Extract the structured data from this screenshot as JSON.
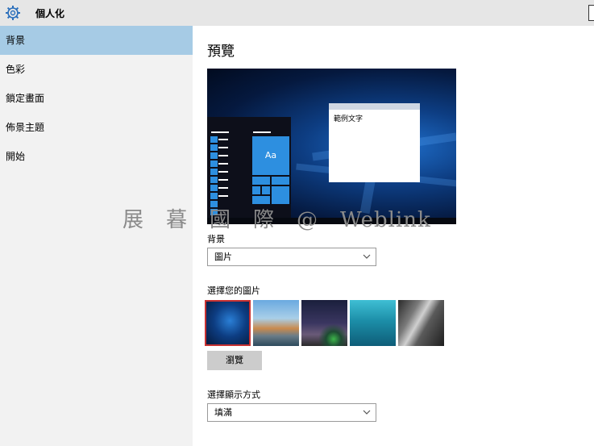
{
  "app": {
    "title": "個人化"
  },
  "sidebar": {
    "items": [
      {
        "label": "背景"
      },
      {
        "label": "色彩"
      },
      {
        "label": "鎖定畫面"
      },
      {
        "label": "佈景主題"
      },
      {
        "label": "開始"
      }
    ]
  },
  "main": {
    "heading": "預覽",
    "preview": {
      "sample_text": "範例文字",
      "tile_label": "Aa"
    },
    "background": {
      "label": "背景",
      "value": "圖片"
    },
    "choose_picture": {
      "label": "選擇您的圖片",
      "browse_label": "瀏覽"
    },
    "fit": {
      "label": "選擇顯示方式",
      "value": "填滿"
    }
  },
  "watermark": "展　暮　國　際　@　Weblink",
  "colors": {
    "selected_nav": "#a6cbe5",
    "accent": "#2d8fe0",
    "selected_thumb_border": "#c83232"
  },
  "icons": {
    "app": "gear-icon",
    "dropdown": "chevron-down-icon"
  }
}
